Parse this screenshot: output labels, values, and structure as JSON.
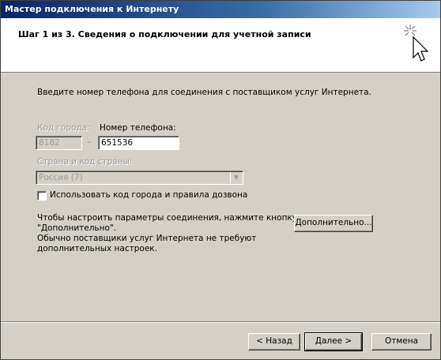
{
  "window": {
    "title": "Мастер подключения к Интернету"
  },
  "header": {
    "step_title": "Шаг 1 из 3. Сведения о подключении для учетной записи",
    "icon": "wizard-wand-cursor-icon"
  },
  "content": {
    "intro": "Введите номер телефона для соединения с поставщиком услуг Интернета.",
    "area_code": {
      "label": "Код города:",
      "value": "8182",
      "enabled": false
    },
    "dash": "–",
    "phone": {
      "label": "Номер телефона:",
      "value": "651536",
      "enabled": true
    },
    "country": {
      "label": "Страна и код страны:",
      "value": "Россия (7)",
      "enabled": false
    },
    "use_area_code": {
      "label": "Использовать код города и правила дозвона",
      "checked": false
    },
    "info_line1": "Чтобы настроить параметры соединения, нажмите кнопку",
    "info_line2": "\"Дополнительно\".",
    "info_line3": "Обычно поставщики услуг Интернета не требуют",
    "info_line4": "дополнительных настроек.",
    "advanced_button": "Дополнительно..."
  },
  "footer": {
    "back_button": "< Назад",
    "next_button": "Далее >",
    "cancel_button": "Отмена"
  }
}
